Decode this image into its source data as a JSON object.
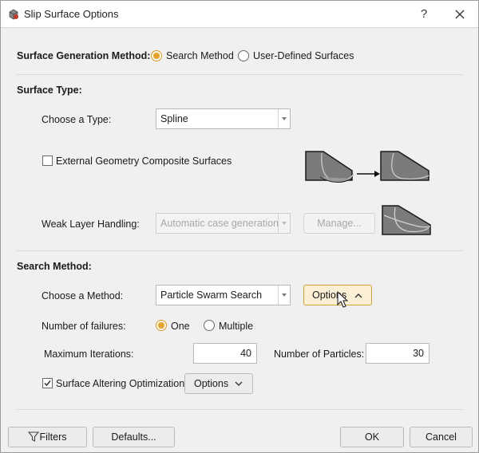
{
  "window": {
    "title": "Slip Surface Options",
    "help": "?"
  },
  "generation": {
    "label": "Surface Generation Method:",
    "options": [
      {
        "label": "Search Method",
        "selected": true
      },
      {
        "label": "User-Defined Surfaces",
        "selected": false
      }
    ]
  },
  "surface_type": {
    "heading": "Surface Type:",
    "choose_label": "Choose a Type:",
    "type_value": "Spline",
    "composite_label": "External Geometry Composite Surfaces",
    "composite_checked": false,
    "weak_label": "Weak Layer Handling:",
    "weak_value": "Automatic case generation",
    "manage_label": "Manage..."
  },
  "search_method": {
    "heading": "Search Method:",
    "choose_label": "Choose a Method:",
    "method_value": "Particle Swarm Search",
    "options_label": "Options",
    "failures_label": "Number of failures:",
    "failures_options": [
      {
        "label": "One",
        "selected": true
      },
      {
        "label": "Multiple",
        "selected": false
      }
    ],
    "max_iter_label": "Maximum Iterations:",
    "max_iter_value": "40",
    "particles_label": "Number of Particles:",
    "particles_value": "30",
    "altering_label": "Surface Altering Optimization",
    "altering_checked": true,
    "altering_options_label": "Options"
  },
  "footer": {
    "filters_label": "Filters",
    "defaults_label": "Defaults...",
    "ok_label": "OK",
    "cancel_label": "Cancel"
  }
}
